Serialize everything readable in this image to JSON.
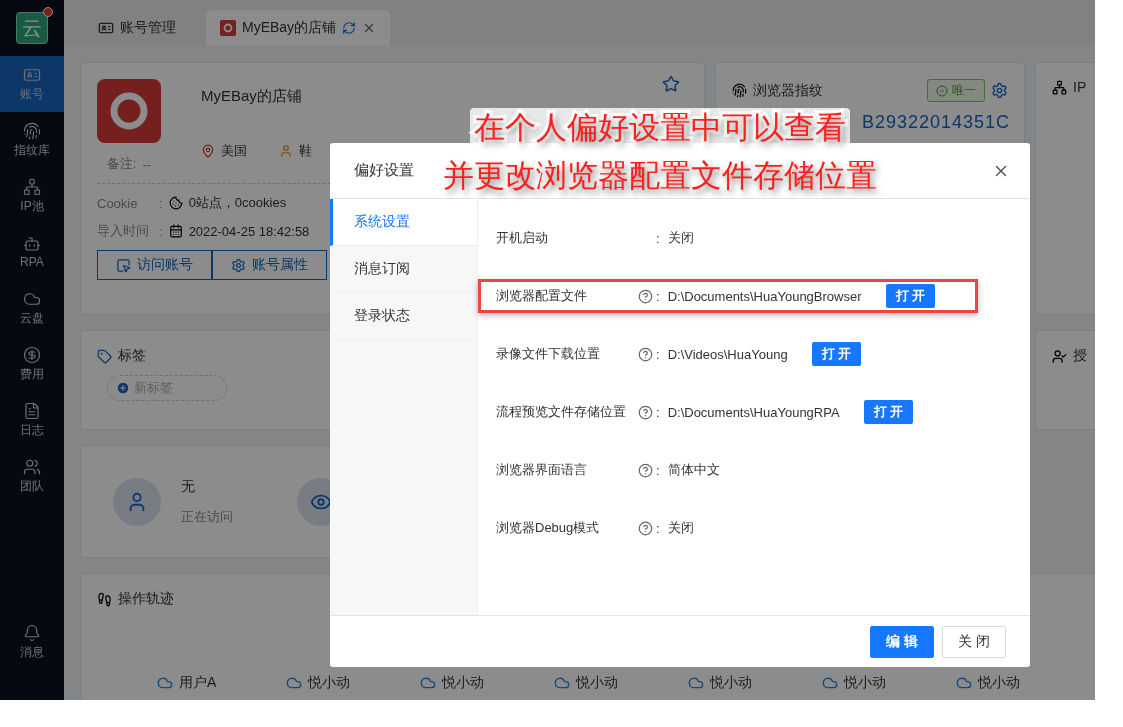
{
  "sidebar": {
    "logo": "云",
    "has_notification": true,
    "items": [
      {
        "label": "账号",
        "selected": true
      },
      {
        "label": "指纹库",
        "selected": false
      },
      {
        "label": "IP池",
        "selected": false
      },
      {
        "label": "RPA",
        "selected": false
      },
      {
        "label": "云盘",
        "selected": false
      },
      {
        "label": "费用",
        "selected": false
      },
      {
        "label": "日志",
        "selected": false
      },
      {
        "label": "团队",
        "selected": false
      }
    ],
    "bottom_items": [
      {
        "label": "消息",
        "selected": false
      }
    ]
  },
  "tabs": [
    {
      "label": "账号管理",
      "selected": false,
      "closable": false
    },
    {
      "label": "MyEBay的店铺",
      "selected": true,
      "closable": true
    }
  ],
  "account": {
    "name": "MyEBay的店铺",
    "country": "美国",
    "category": "鞋",
    "note_label": "备注:",
    "note": "--",
    "separator": ":",
    "cookie_label": "Cookie",
    "cookie_value": "0站点，0cookies",
    "import_label": "导入时间",
    "import_value": "2022-04-25 18:42:58",
    "buttons": [
      "访问账号",
      "账号属性"
    ]
  },
  "fingerprint": {
    "title": "浏览器指纹",
    "badge": "唯一",
    "value": "B29322014351C"
  },
  "ip_card": {
    "title": "IP"
  },
  "tags_card": {
    "title": "标签",
    "add_label": "新标签"
  },
  "auth_card": {
    "title": "授"
  },
  "visitor": {
    "name": "无",
    "status": "正在访问"
  },
  "track": {
    "title": "操作轨迹",
    "items": [
      "用户A",
      "悦小动",
      "悦小动",
      "悦小动",
      "悦小动",
      "悦小动",
      "悦小动"
    ]
  },
  "dialog": {
    "title": "偏好设置",
    "separator": ":",
    "menu": [
      {
        "label": "系统设置",
        "selected": true
      },
      {
        "label": "消息订阅",
        "selected": false
      },
      {
        "label": "登录状态",
        "selected": false
      }
    ],
    "rows": [
      {
        "label": "开机启动",
        "help": false,
        "value": "关闭",
        "highlighted": false
      },
      {
        "label": "浏览器配置文件",
        "help": true,
        "value": "D:\\Documents\\HuaYoungBrowser",
        "open_button": "打 开",
        "highlighted": true
      },
      {
        "label": "录像文件下载位置",
        "help": true,
        "value": "D:\\Videos\\HuaYoung",
        "open_button": "打 开",
        "highlighted": false
      },
      {
        "label": "流程预览文件存储位置",
        "help": true,
        "value": "D:\\Documents\\HuaYoungRPA",
        "open_button": "打 开",
        "highlighted": false
      },
      {
        "label": "浏览器界面语言",
        "help": true,
        "value": "简体中文",
        "highlighted": false
      },
      {
        "label": "浏览器Debug模式",
        "help": true,
        "value": "关闭",
        "highlighted": false
      }
    ],
    "buttons": [
      {
        "label": "编 辑",
        "kind": "primary"
      },
      {
        "label": "关 闭",
        "kind": "default"
      }
    ]
  },
  "annotation": {
    "lines": [
      "在个人偏好设置中可以查看",
      "并更改浏览器配置文件存储位置"
    ]
  }
}
